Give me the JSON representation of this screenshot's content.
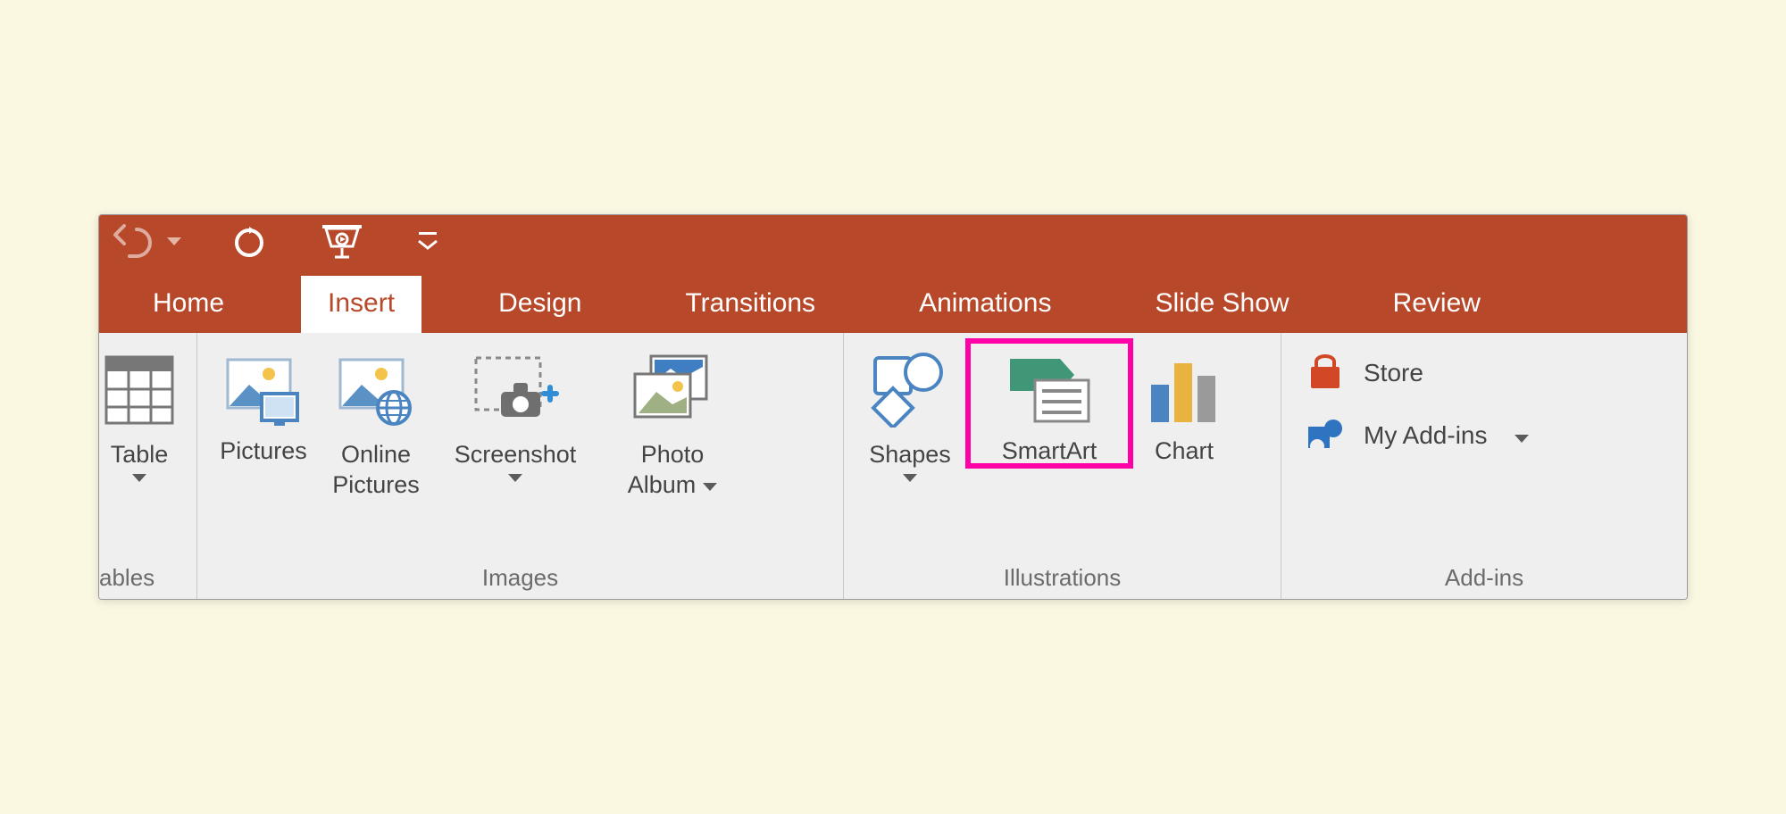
{
  "tabs": {
    "home": "Home",
    "insert": "Insert",
    "design": "Design",
    "transitions": "Transitions",
    "animations": "Animations",
    "slideshow": "Slide Show",
    "review": "Review"
  },
  "groups": {
    "tables": {
      "label": "ables",
      "table": "Table"
    },
    "images": {
      "label": "Images",
      "pictures": "Pictures",
      "online_pictures_line1": "Online",
      "online_pictures_line2": "Pictures",
      "screenshot": "Screenshot",
      "photo_album_line1": "Photo",
      "photo_album_line2": "Album"
    },
    "illustrations": {
      "label": "Illustrations",
      "shapes": "Shapes",
      "smartart": "SmartArt",
      "chart": "Chart"
    },
    "addins": {
      "label": "Add-ins",
      "store": "Store",
      "my_addins": "My Add-ins"
    }
  }
}
